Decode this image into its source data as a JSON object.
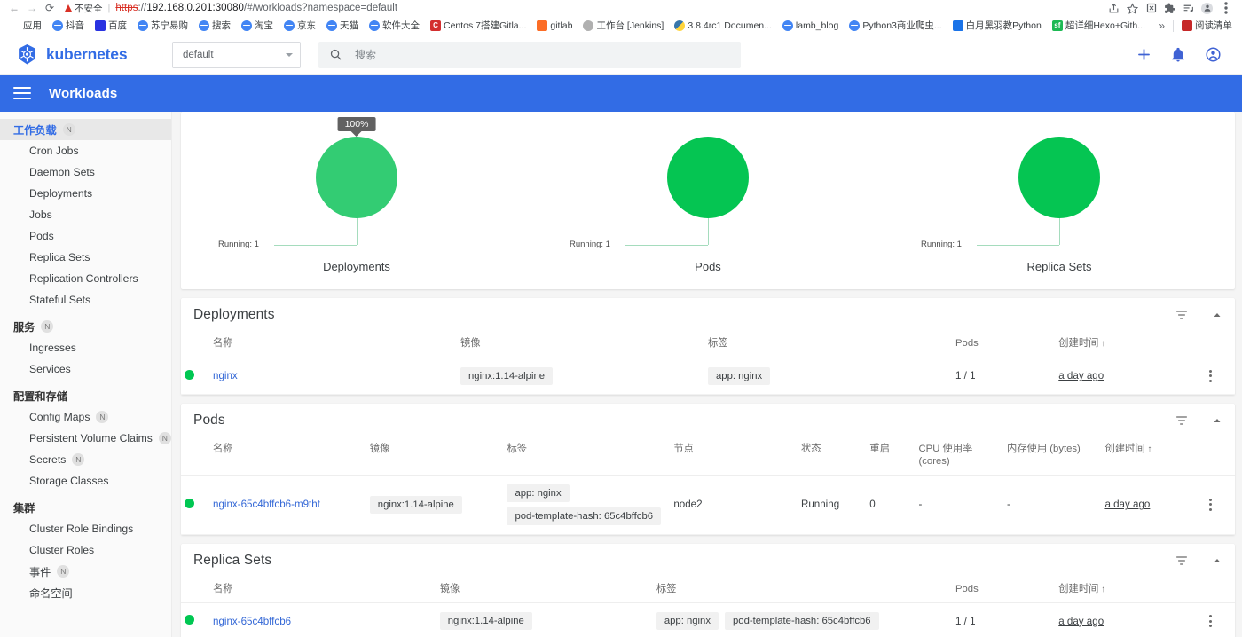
{
  "browser": {
    "nav": {
      "back": "back-arrow",
      "forward": "forward-arrow",
      "reload": "reload"
    },
    "security": {
      "label": "不安全",
      "icon": "warning-triangle"
    },
    "url": {
      "scheme": "https",
      "sep": "://",
      "host": "192.168.0.201:30080",
      "path": "/#/workloads?namespace=default"
    },
    "omni_icons": [
      "share-icon",
      "bookmark-star-icon",
      "extension-x-icon",
      "puzzle-extension-icon",
      "list-play-icon",
      "profile-avatar-icon",
      "kebab-menu-icon"
    ],
    "bookmarks": [
      {
        "label": "应用",
        "fav": "apps-grid"
      },
      {
        "label": "抖音",
        "fav": "globe"
      },
      {
        "label": "百度",
        "fav": "baidu"
      },
      {
        "label": "苏宁易购",
        "fav": "globe"
      },
      {
        "label": "搜索",
        "fav": "globe"
      },
      {
        "label": "淘宝",
        "fav": "globe"
      },
      {
        "label": "京东",
        "fav": "globe"
      },
      {
        "label": "天猫",
        "fav": "globe"
      },
      {
        "label": "软件大全",
        "fav": "globe"
      },
      {
        "label": "Centos 7搭建Gitla...",
        "fav": "letter-c"
      },
      {
        "label": "gitlab",
        "fav": "gitlab-fox"
      },
      {
        "label": "工作台 [Jenkins]",
        "fav": "jenkins"
      },
      {
        "label": "3.8.4rc1 Documen...",
        "fav": "python"
      },
      {
        "label": "lamb_blog",
        "fav": "globe"
      },
      {
        "label": "Python3商业爬虫...",
        "fav": "globe"
      },
      {
        "label": "白月黑羽教Python",
        "fav": "blue-square"
      },
      {
        "label": "超详细Hexo+Gith...",
        "fav": "sf-green"
      }
    ],
    "bookmarks_overflow": "»",
    "reading_list": {
      "label": "阅读清单",
      "fav": "reading-list"
    }
  },
  "app": {
    "brand": "kubernetes",
    "namespace": {
      "value": "default"
    },
    "search": {
      "placeholder": "搜索"
    },
    "toolbar_icons": [
      "plus-icon",
      "bell-icon",
      "account-circle-icon"
    ],
    "page_title": "Workloads"
  },
  "sidebar": {
    "groups": [
      {
        "label": "工作负载",
        "badge": "N",
        "active": true,
        "items": [
          {
            "label": "Cron Jobs",
            "badge": ""
          },
          {
            "label": "Daemon Sets",
            "badge": ""
          },
          {
            "label": "Deployments",
            "badge": ""
          },
          {
            "label": "Jobs",
            "badge": ""
          },
          {
            "label": "Pods",
            "badge": ""
          },
          {
            "label": "Replica Sets",
            "badge": ""
          },
          {
            "label": "Replication Controllers",
            "badge": ""
          },
          {
            "label": "Stateful Sets",
            "badge": ""
          }
        ]
      },
      {
        "label": "服务",
        "badge": "N",
        "active": false,
        "items": [
          {
            "label": "Ingresses",
            "badge": ""
          },
          {
            "label": "Services",
            "badge": ""
          }
        ]
      },
      {
        "label": "配置和存储",
        "badge": "",
        "active": false,
        "items": [
          {
            "label": "Config Maps",
            "badge": "N"
          },
          {
            "label": "Persistent Volume Claims",
            "badge": "N"
          },
          {
            "label": "Secrets",
            "badge": "N"
          },
          {
            "label": "Storage Classes",
            "badge": ""
          }
        ]
      },
      {
        "label": "集群",
        "badge": "",
        "active": false,
        "items": [
          {
            "label": "Cluster Role Bindings",
            "badge": ""
          },
          {
            "label": "Cluster Roles",
            "badge": ""
          },
          {
            "label": "事件",
            "badge": "N"
          },
          {
            "label": "命名空间",
            "badge": ""
          }
        ]
      }
    ]
  },
  "chart_data": {
    "type": "pie",
    "title": "Workload status",
    "legend_position": "bottom-left",
    "charts": [
      {
        "title": "Deployments",
        "categories": [
          "Running"
        ],
        "values": [
          1
        ],
        "percent": "100%",
        "legend": "Running: 1",
        "tooltip": "100%",
        "color": "#33cc73",
        "tooltip_visible": true
      },
      {
        "title": "Pods",
        "categories": [
          "Running"
        ],
        "values": [
          1
        ],
        "percent": "100%",
        "legend": "Running: 1",
        "tooltip": "100%",
        "color": "#05c552",
        "tooltip_visible": false
      },
      {
        "title": "Replica Sets",
        "categories": [
          "Running"
        ],
        "values": [
          1
        ],
        "percent": "100%",
        "legend": "Running: 1",
        "tooltip": "100%",
        "color": "#05c552",
        "tooltip_visible": false
      }
    ]
  },
  "tables": {
    "deployments": {
      "title": "Deployments",
      "columns": [
        "名称",
        "镜像",
        "标签",
        "Pods",
        "创建时间"
      ],
      "sort_column_index": 4,
      "sort_arrow": "↑",
      "rows": [
        {
          "status": "green",
          "name": "nginx",
          "image": "nginx:1.14-alpine",
          "labels": [
            "app: nginx"
          ],
          "pods": "1 / 1",
          "created": "a day ago"
        }
      ]
    },
    "pods": {
      "title": "Pods",
      "columns": [
        "名称",
        "镜像",
        "标签",
        "节点",
        "状态",
        "重启",
        "CPU 使用率 (cores)",
        "内存使用 (bytes)",
        "创建时间"
      ],
      "cpu_col_line1": "CPU 使用率",
      "cpu_col_line2": "(cores)",
      "sort_column_index": 8,
      "sort_arrow": "↑",
      "rows": [
        {
          "status": "green",
          "name": "nginx-65c4bffcb6-m9tht",
          "image": "nginx:1.14-alpine",
          "labels": [
            "app: nginx",
            "pod-template-hash: 65c4bffcb6"
          ],
          "node": "node2",
          "state": "Running",
          "restarts": "0",
          "cpu": "-",
          "memory": "-",
          "created": "a day ago"
        }
      ]
    },
    "replicasets": {
      "title": "Replica Sets",
      "columns": [
        "名称",
        "镜像",
        "标签",
        "Pods",
        "创建时间"
      ],
      "sort_column_index": 4,
      "sort_arrow": "↑",
      "rows": [
        {
          "status": "green",
          "name": "nginx-65c4bffcb6",
          "image": "nginx:1.14-alpine",
          "labels": [
            "app: nginx",
            "pod-template-hash: 65c4bffcb6"
          ],
          "pods": "1 / 1",
          "created": "a day ago"
        }
      ]
    }
  },
  "colors": {
    "brand_blue": "#326ce5",
    "status_green": "#00c752",
    "link_blue": "#3367d6",
    "tooltip_gray": "#616161"
  }
}
